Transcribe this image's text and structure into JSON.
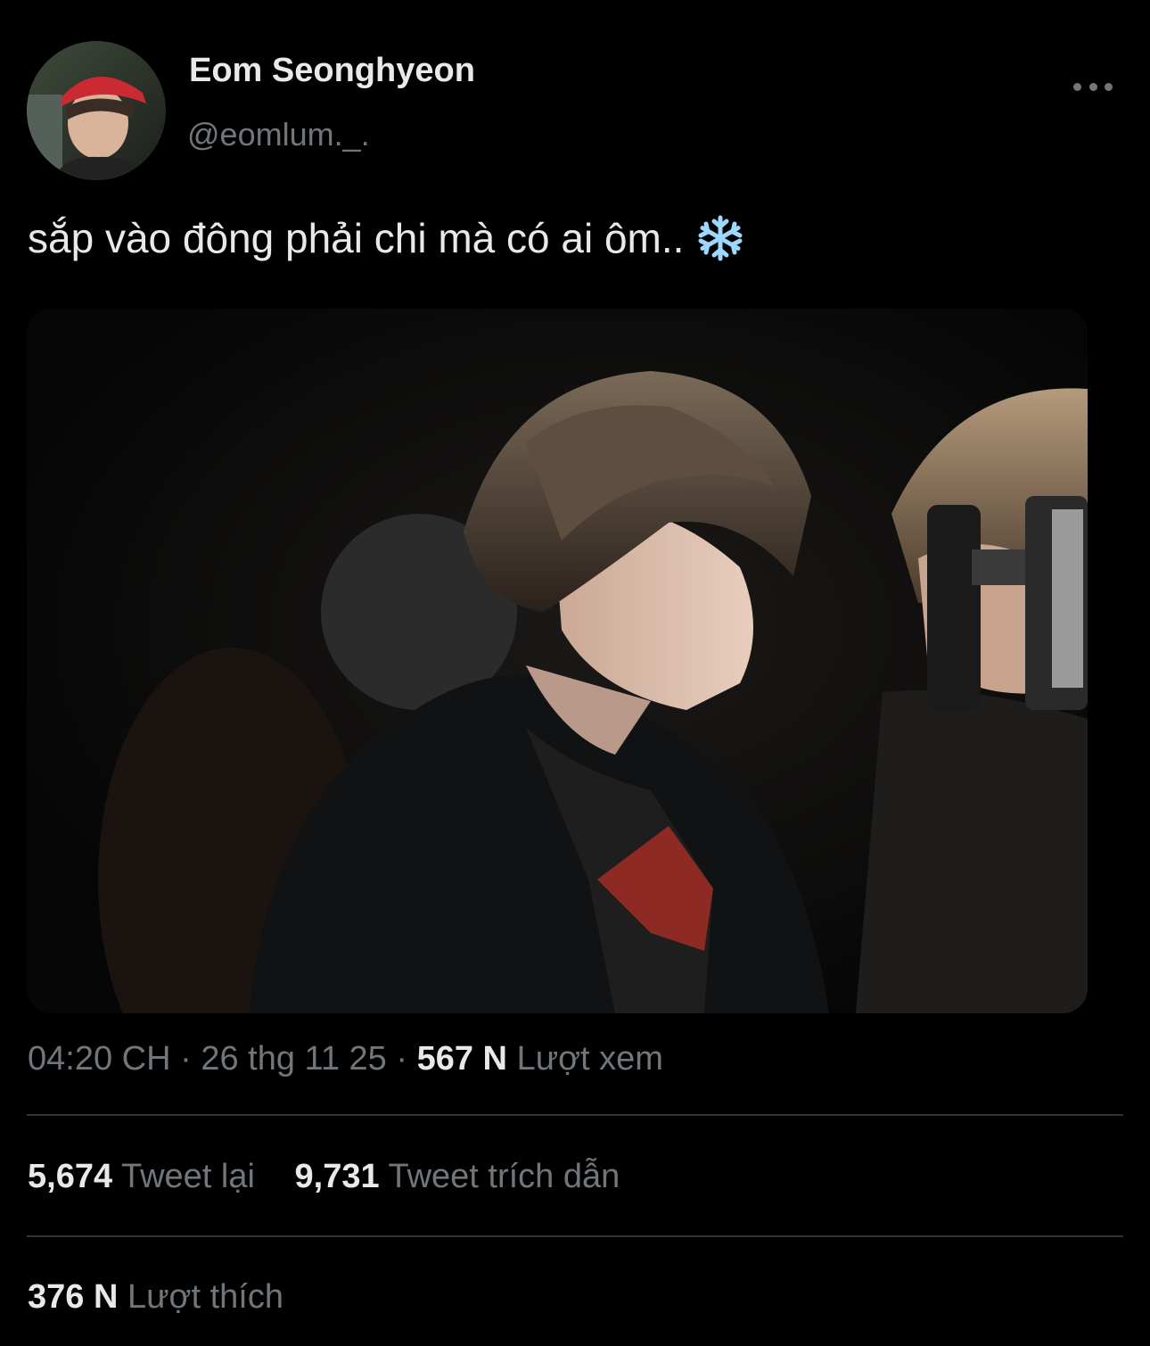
{
  "author": {
    "display_name": "Eom Seonghyeon",
    "handle": "@eomlum._."
  },
  "tweet": {
    "text": "sắp vào đông phải chi mà có ai ôm..",
    "emoji": "snowflake"
  },
  "meta": {
    "time": "04:20 CH",
    "separator": "·",
    "date": "26 thg 11 25",
    "views_count": "567 N",
    "views_label": "Lượt xem"
  },
  "stats": {
    "retweets_count": "5,674",
    "retweets_label": "Tweet lại",
    "quotes_count": "9,731",
    "quotes_label": "Tweet trích dẫn",
    "likes_count": "376 N",
    "likes_label": "Lượt thích"
  },
  "icons": {
    "more": "more-horizontal-icon",
    "snowflake": "snowflake-icon"
  },
  "colors": {
    "background": "#000000",
    "primary_text": "#e7e9ea",
    "secondary_text": "#71767b",
    "divider": "#2f3336",
    "snowflake": "#9fd8ff"
  }
}
